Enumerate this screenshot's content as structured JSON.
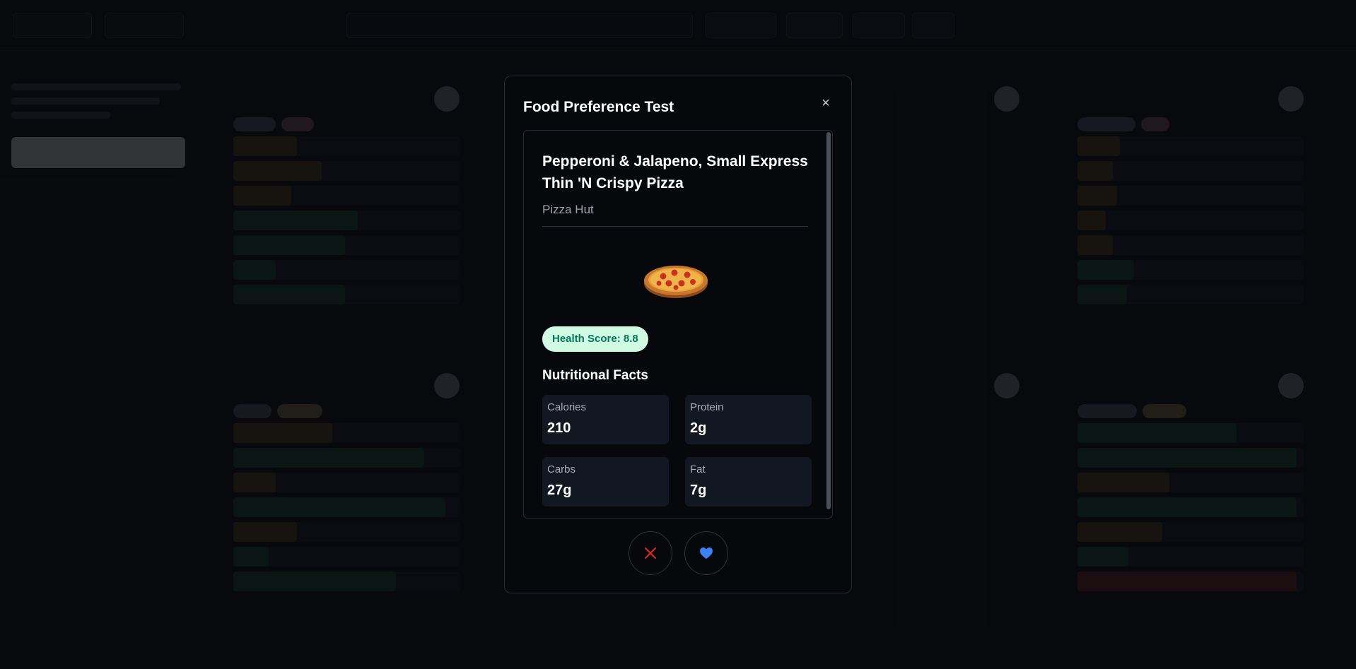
{
  "modal": {
    "title": "Food Preference Test",
    "close_symbol": "×",
    "food": {
      "name": "Pepperoni & Jalapeno, Small Express Thin 'N Crispy Pizza",
      "brand": "Pizza Hut",
      "image_icon": "pizza-icon",
      "health_score": "Health Score: 8.8"
    },
    "nutrition": {
      "title": "Nutritional Facts",
      "items": [
        {
          "label": "Calories",
          "value": "210"
        },
        {
          "label": "Protein",
          "value": "2g"
        },
        {
          "label": "Carbs",
          "value": "27g"
        },
        {
          "label": "Fat",
          "value": "7g"
        }
      ]
    },
    "actions": {
      "dislike_icon": "x-icon",
      "like_icon": "heart-icon"
    }
  },
  "colors": {
    "accent_blue": "#3b82f6",
    "dislike_red": "#dc2626",
    "health_bg": "#d1fae5",
    "health_text": "#047857"
  }
}
